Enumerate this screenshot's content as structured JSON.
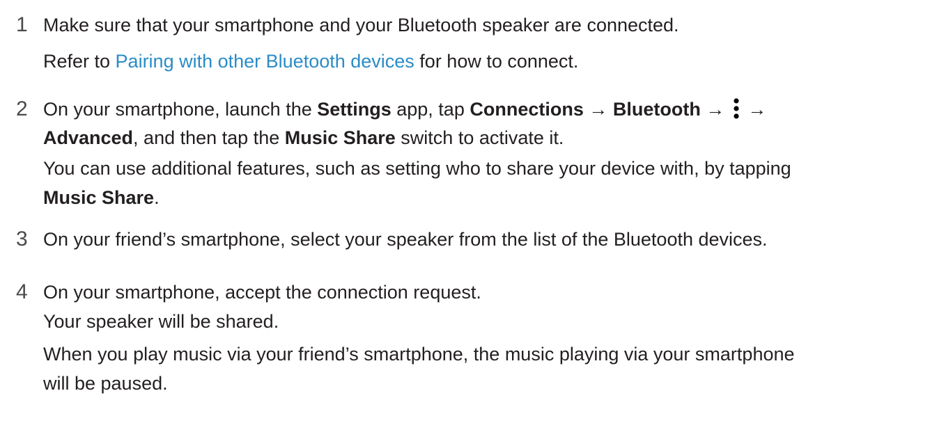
{
  "steps": [
    {
      "number": "1",
      "line1": "Make sure that your smartphone and your Bluetooth speaker are connected.",
      "refer_prefix": "Refer to ",
      "refer_link": "Pairing with other Bluetooth devices",
      "refer_suffix": " for how to connect."
    },
    {
      "number": "2",
      "t1": "On your smartphone, launch the ",
      "settings": "Settings",
      "t2": " app, tap ",
      "connections": "Connections",
      "arrow1": " → ",
      "bluetooth": "Bluetooth",
      "arrow2": " → ",
      "arrow3": " →",
      "advanced": "Advanced",
      "t3": ", and then tap the ",
      "music_share": "Music Share",
      "t4": " switch to activate it.",
      "extra1": "You can use additional features, such as setting who to share your device with, by tapping",
      "extra_bold": "Music Share",
      "extra_end": "."
    },
    {
      "number": "3",
      "line1": "On your friend’s smartphone, select your speaker from the list of the Bluetooth devices."
    },
    {
      "number": "4",
      "line1": "On your smartphone, accept the connection request.",
      "line2": "Your speaker will be shared.",
      "line3": "When you play music via your friend’s smartphone, the music playing via your smartphone",
      "line4": "will be paused."
    }
  ],
  "icons": {
    "more_options": "more-options-icon"
  }
}
